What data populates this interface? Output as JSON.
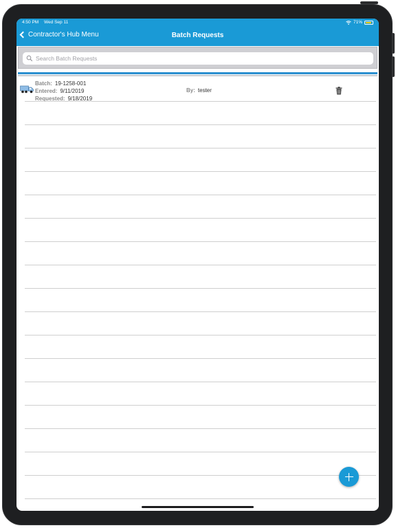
{
  "status": {
    "time": "4:50 PM",
    "date": "Wed Sep 11",
    "battery": "71%",
    "icons": [
      "wifi-icon",
      "battery-icon"
    ]
  },
  "nav": {
    "back_label": "Contractor's Hub Menu",
    "title": "Batch Requests"
  },
  "search": {
    "placeholder": "Search Batch Requests"
  },
  "batches": [
    {
      "batch_label": "Batch:",
      "batch_value": "19-1258-001",
      "entered_label": "Entered:",
      "entered_value": "9/11/2019",
      "requested_label": "Requested:",
      "requested_value": "9/18/2019",
      "by_label": "By:",
      "by_value": "tester",
      "icon": "truck-icon",
      "action_icon": "trash-icon"
    }
  ],
  "fab": {
    "icon": "plus-icon"
  },
  "colors": {
    "accent": "#1a9ad6",
    "divider": "#2a8fcf"
  }
}
